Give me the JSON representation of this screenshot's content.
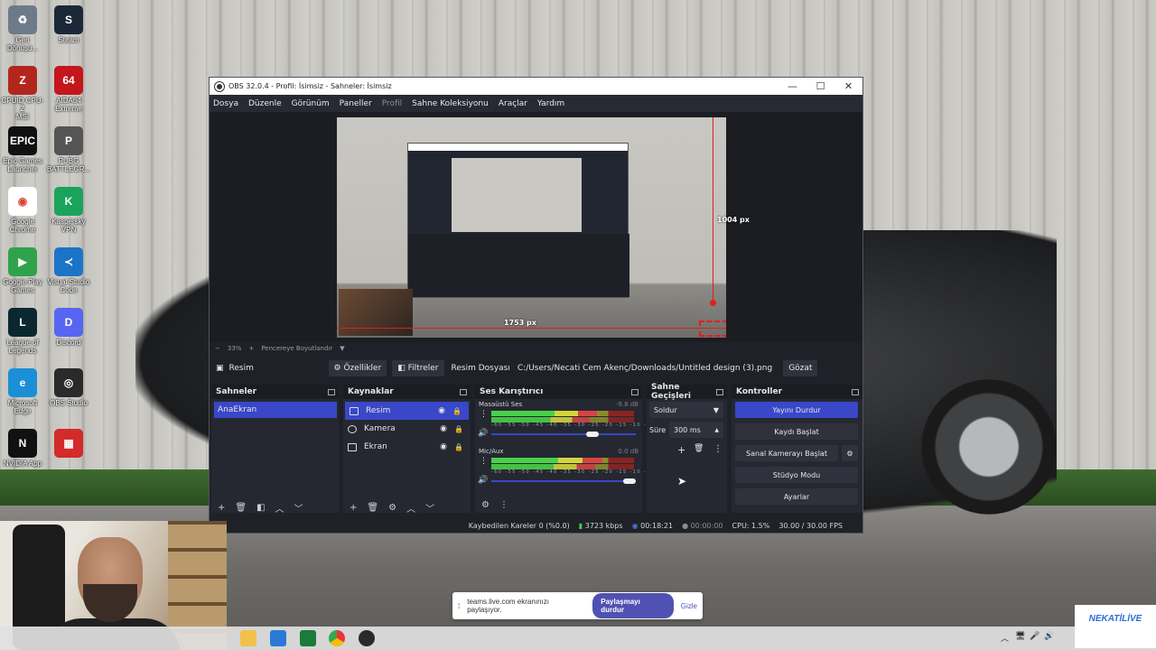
{
  "desktop": {
    "icons": [
      {
        "label": "Geri\nDönüşü...",
        "color": "#6c7a8a",
        "glyph": "♻"
      },
      {
        "label": "Steam",
        "color": "#1b2838",
        "glyph": "S"
      },
      {
        "label": "CPUID CPU-Z\nMSI",
        "color": "#b3261e",
        "glyph": "Z"
      },
      {
        "label": "AIDA64\nExtreme",
        "color": "#c4161c",
        "glyph": "64"
      },
      {
        "label": "Epic Games\nLauncher",
        "color": "#111111",
        "glyph": "EPIC"
      },
      {
        "label": "PUBG\nBATTLEGR...",
        "color": "#555555",
        "glyph": "P"
      },
      {
        "label": "Google\nChrome",
        "color": "#ffffff",
        "glyph": "◉"
      },
      {
        "label": "Kaspersky\nVPN",
        "color": "#1aa35b",
        "glyph": "K"
      },
      {
        "label": "Google Play\nGames",
        "color": "#2fa34b",
        "glyph": "▶"
      },
      {
        "label": "Visual Studio\nCode",
        "color": "#1c74c8",
        "glyph": "≺"
      },
      {
        "label": "League of\nLegends",
        "color": "#0b2830",
        "glyph": "L"
      },
      {
        "label": "Discord",
        "color": "#5865f2",
        "glyph": "D"
      },
      {
        "label": "Microsoft\nEdge",
        "color": "#1b8fd6",
        "glyph": "e"
      },
      {
        "label": "OBS Studio",
        "color": "#2a2a2a",
        "glyph": "◎"
      },
      {
        "label": "NVIDIA App",
        "color": "#111111",
        "glyph": "N"
      },
      {
        "label": "",
        "color": "#d32a2a",
        "glyph": "▦"
      }
    ]
  },
  "obs": {
    "window_title": "OBS 32.0.4 - Profil: İsimsiz - Sahneler: İsimsiz",
    "window_buttons": [
      "—",
      "☐",
      "✕"
    ],
    "menu": [
      "Dosya",
      "Düzenle",
      "Görünüm",
      "Paneller",
      "Profil",
      "Sahne Koleksiyonu",
      "Araçlar",
      "Yardım"
    ],
    "preview": {
      "label_vertical_px": "1004 px",
      "label_horizontal_px": "1753 px",
      "zoom": "33%",
      "fit_label": "Pencereye Boyutlandır"
    },
    "source_toolbar": {
      "selected_source": "Resim",
      "properties": "Özellikler",
      "filters": "Filtreler",
      "file_label": "Resim Dosyası",
      "file_path": "C:/Users/Necati Cem Akenç/Downloads/Untitled design (3).png",
      "browse": "Gözat"
    },
    "docks": {
      "scenes": {
        "title": "Sahneler",
        "items": [
          "AnaEkran"
        ]
      },
      "sources": {
        "title": "Kaynaklar",
        "items": [
          "Resim",
          "Kamera",
          "Ekran"
        ]
      },
      "mixer": {
        "title": "Ses Karıştırıcı",
        "channels": [
          {
            "name": "Masaüstü Ses",
            "db": "-9.8 dB",
            "level": 0.74,
            "volume": 0.72
          },
          {
            "name": "Mic/Aux",
            "db": "0.0 dB",
            "level": 0.78,
            "volume": 1.0
          }
        ],
        "ticks": "-60 -55 -50 -45 -40 -35 -30 -25 -20 -15 -10 -5 0"
      },
      "transitions": {
        "title": "Sahne Geçişleri",
        "type": "Soldur",
        "duration_label": "Süre",
        "duration": "300 ms"
      },
      "controls": {
        "title": "Kontroller",
        "buttons": [
          "Yayını Durdur",
          "Kaydı Başlat",
          "Sanal Kamerayı Başlat",
          "Stüdyo Modu",
          "Ayarlar"
        ]
      }
    },
    "status": {
      "dropped_frames": "Kaybedilen Kareler 0 (%0.0)",
      "bitrate": "3723 kbps",
      "stream_time": "00:18:21",
      "record_time": "00:00:00",
      "cpu": "CPU: 1.5%",
      "fps": "30.00 / 30.00 FPS"
    }
  },
  "share_bar": {
    "message": "teams.live.com ekranınızı paylaşıyor.",
    "stop": "Paylaşmayı durdur",
    "hide": "Gizle"
  },
  "watermark": "NEKATİLİVE"
}
